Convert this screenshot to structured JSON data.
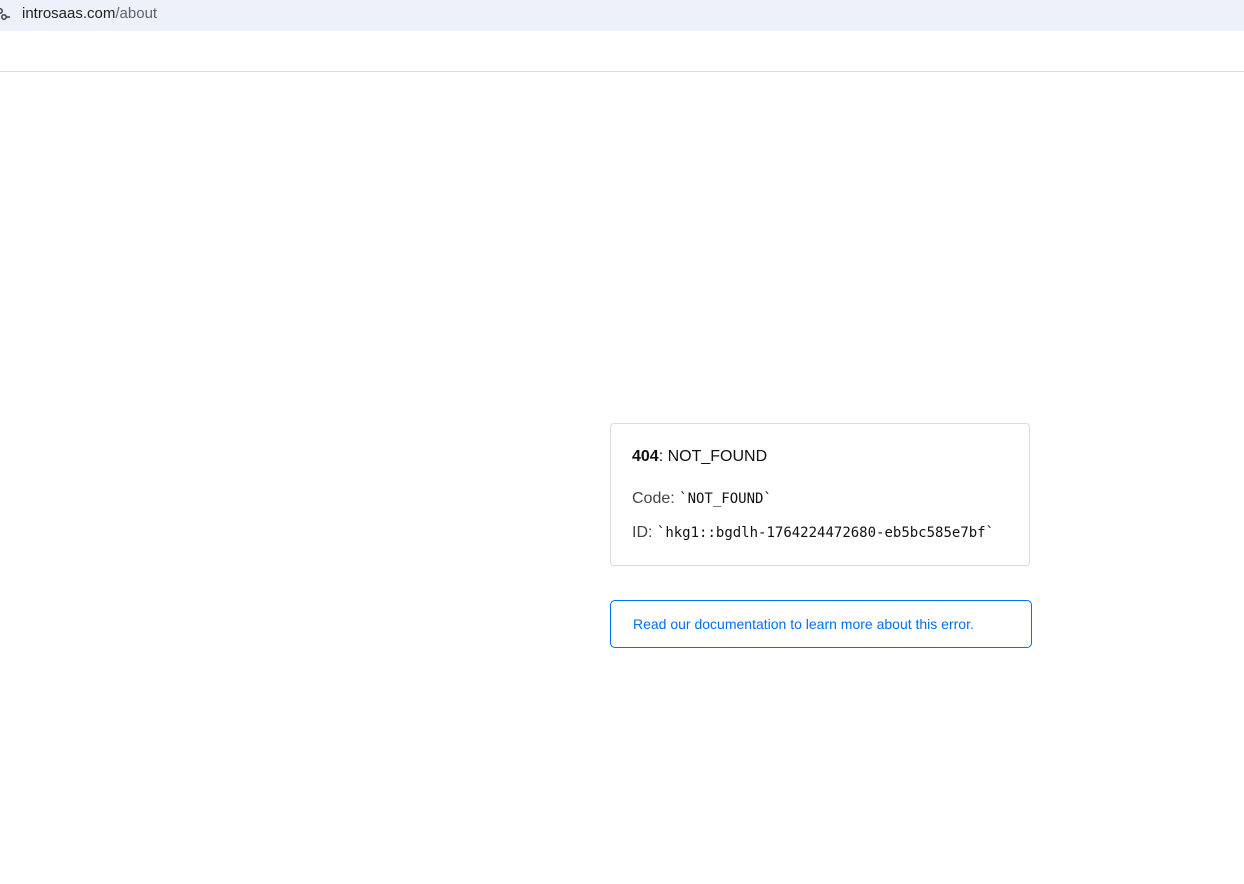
{
  "browser": {
    "url_host": "introsaas.com",
    "url_path": "/about",
    "site_info_icon": "tune-icon"
  },
  "error": {
    "status_code": "404",
    "status_sep": ": ",
    "status_text": "NOT_FOUND",
    "code_label": "Code: ",
    "code_value": "`NOT_FOUND`",
    "id_label": "ID: ",
    "id_value": "`hkg1::bgdlh-1764224472680-eb5bc585e7bf`"
  },
  "docs": {
    "link_text": "Read our documentation to learn more about this error."
  },
  "colors": {
    "link": "#0070f3",
    "address_bar_bg": "#edf2fa"
  }
}
